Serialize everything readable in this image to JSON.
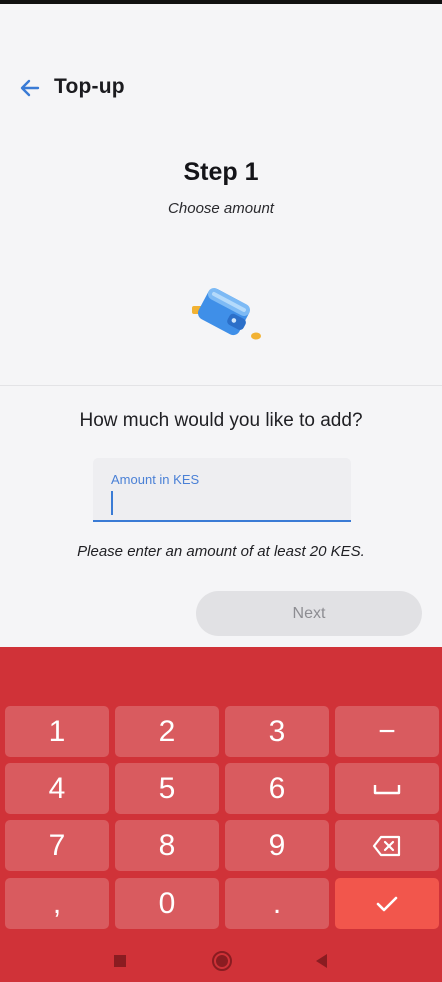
{
  "header": {
    "back_icon": "arrow-left-icon",
    "title": "Top-up"
  },
  "step": {
    "title": "Step 1",
    "subtitle": "Choose amount"
  },
  "illustration": {
    "icon": "wallet-icon"
  },
  "form": {
    "question": "How much would you like to add?",
    "amount_label": "Amount in KES",
    "amount_value": "",
    "hint": "Please enter an amount of at least 20 KES."
  },
  "next_button": {
    "label": "Next",
    "enabled": false
  },
  "keyboard": {
    "keys": [
      "1",
      "2",
      "3",
      "−",
      "4",
      "5",
      "6",
      "␣",
      "7",
      "8",
      "9",
      "⌫",
      ",",
      "0",
      ".",
      "✓"
    ],
    "icons": {
      "space": "space-bar-icon",
      "backspace": "backspace-icon",
      "enter": "checkmark-icon"
    }
  },
  "nav_bar": {
    "icons": [
      "recents-square-icon",
      "home-circle-icon",
      "back-triangle-icon"
    ]
  },
  "colors": {
    "accent": "#3a7bd5",
    "keyboard_bg": "#d03238",
    "enter_key": "#f2564c",
    "background": "#f5f5f7"
  }
}
